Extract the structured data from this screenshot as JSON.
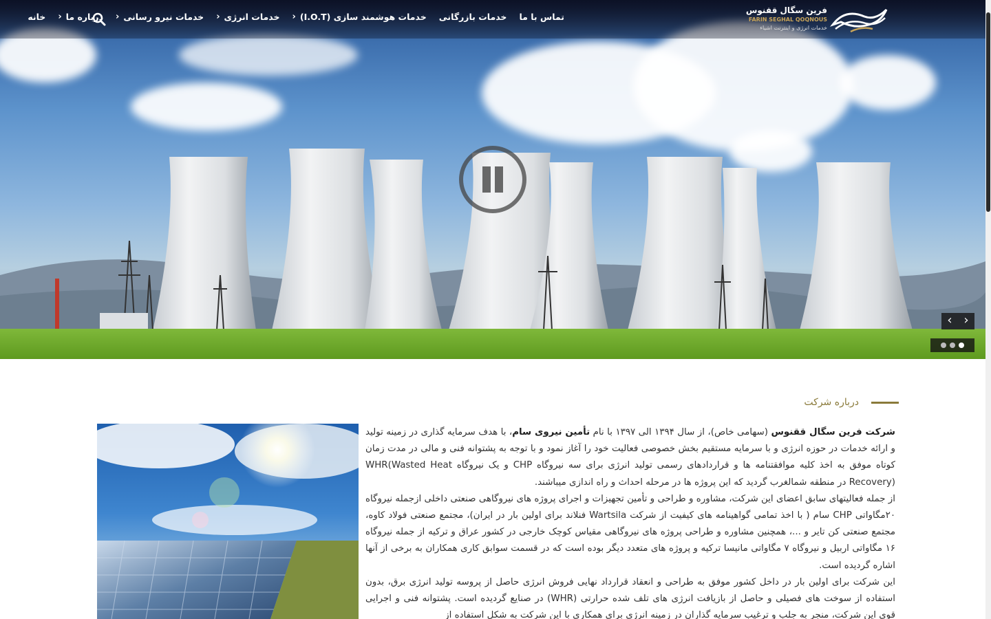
{
  "nav": {
    "items": [
      {
        "label": "خانه",
        "has_submenu": false
      },
      {
        "label": "درباره ما",
        "has_submenu": true
      },
      {
        "label": "خدمات نیرو رسانی",
        "has_submenu": true
      },
      {
        "label": "خدمات انرژی",
        "has_submenu": true
      },
      {
        "label": "خدمات هوشمند سازی (I.O.T)",
        "has_submenu": true
      },
      {
        "label": "خدمات بازرگانی",
        "has_submenu": false
      },
      {
        "label": "تماس با ما",
        "has_submenu": false
      }
    ],
    "search_icon": "search-icon"
  },
  "logo": {
    "name_fa": "فرین سگال ققنوس",
    "name_en": "FARIN SEGHAL QOQNOUS",
    "tagline": "خدمات انرژی و اینترنت اشیاء"
  },
  "slider": {
    "prev_symbol": "‹",
    "next_symbol": "›",
    "slide_count": 3,
    "active_slide": 1
  },
  "about": {
    "section_title": "درباره شرکت",
    "p1_company": "شرکت فرین سگال ققنوس",
    "p1_a": " (سهامی خاص)، از سال ۱۳۹۴ الی ۱۳۹۷ با نام ",
    "p1_brand": "تأمین نیروی سام",
    "p1_b": "،  با هدف سرمایه گذاری  در زمینه تولید و ارائه خدمات در حوزه انرژی و با سرمایه مستقیم بخش خصوصی فعالیت خود را آغاز نمود و با توجه به پشتوانه فنی و مالی در مدت زمان کوتاه موفق به اخذ کلیه موافقتنامه ها و قراردادهای رسمی تولید انرژی برای سه نیروگاه CHP و یک نیروگاه WHR(Wasted Heat Recovery) در منطقه شمالغرب گردید که این پروژه ها در مرحله احداث و راه اندازی میباشند.",
    "p2": "از جمله فعالیتهای سابق اعضای این شرکت، مشاوره و طراحی و تأمین تجهیزات و اجرای پروژه های نیروگاهی صنعتی داخلی ازجمله نیروگاه ۲۰مگاواتی CHP سام ( با اخذ تمامی گواهینامه های کیفیت از شرکت Wartsila فنلاند برای اولین بار در ایران)، مجتمع صنعتی فولاد کاوه، مجتمع صنعتی کن تایر و ...، همچنین مشاوره و طراحی پروژه های نیروگاهی مقیاس کوچک خارجی در کشور عراق و ترکیه از جمله نیروگاه ۱۶ مگاواتی اربیل و نیروگاه ۷ مگاواتی مانیسا ترکیه و پروژه های متعدد دیگر بوده است که در قسمت سوابق کاری همکاران به برخی از آنها اشاره گردیده است.",
    "p3": "این شرکت برای اولین بار در داخل کشور موفق به طراحی و انعقاد قرارداد نهایی فروش انرژی حاصل از پروسه  تولید انرژی برق، بدون استفاده از سوخت های فصیلی و حاصل از بازیافت انرژی های تلف شده حرارتی (WHR) در صنایع  گردیده است. پشتوانه فنی و اجرایی قوی این شرکت، منجر به جلب و ترغیب سرمایه گذاران در زمینه انرژی برای همکاری با  این شرکت به شکل استفاده از"
  },
  "colors": {
    "accent_gold": "#8a7a3a",
    "nav_text": "#ffffff",
    "body_text": "#333333"
  }
}
